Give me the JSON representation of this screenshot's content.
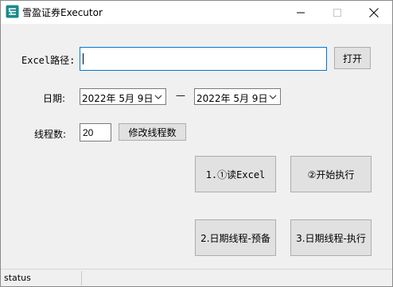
{
  "window": {
    "title": "雪盈证券Executor",
    "icon": "app-logo-icon",
    "controls": [
      "minimize-icon",
      "maximize-icon",
      "close-icon"
    ]
  },
  "form": {
    "excel_path_label": "Excel路径:",
    "excel_path_value": "",
    "open_button": "打开",
    "date_label": "日期:",
    "start_date": "2022年 5月 9日",
    "date_separator": "—",
    "end_date": "2022年 5月 9日",
    "threads_label": "线程数:",
    "threads_value": "20",
    "modify_threads_button": "修改线程数"
  },
  "actions": {
    "read_excel": "1.①读Excel",
    "start_execute": "②开始执行",
    "date_thread_prefetch": "2.日期线程-预备",
    "date_thread_execute": "3.日期线程-执行"
  },
  "status": {
    "text": "status"
  },
  "colors": {
    "window_bg": "#f0f0f0",
    "titlebar_bg": "#ffffff",
    "focus_border": "#0078d7",
    "button_bg": "#e1e1e1",
    "button_border": "#adadad",
    "logo": "#1a8a8c"
  }
}
